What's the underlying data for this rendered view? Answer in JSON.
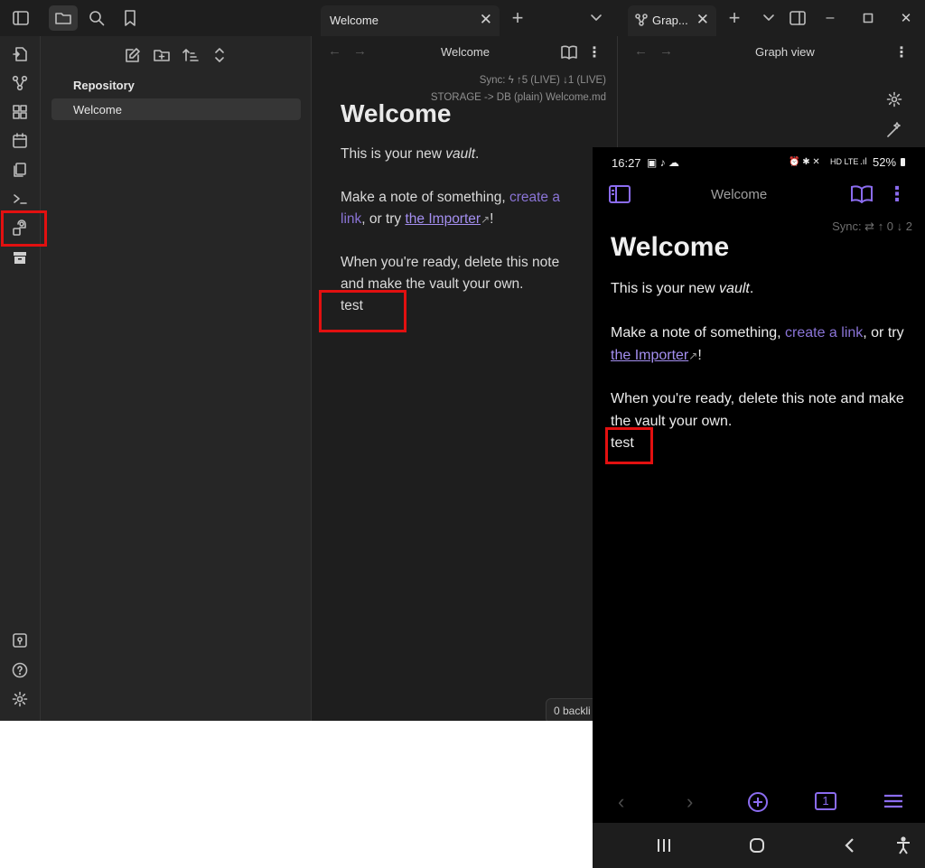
{
  "titlebar": {
    "tabs": [
      {
        "label": "Welcome"
      },
      {
        "label": "Grap..."
      }
    ],
    "new_tab": "+"
  },
  "sidebar": {
    "root_label": "Repository",
    "items": [
      {
        "label": "Welcome"
      }
    ]
  },
  "editor": {
    "header_title": "Welcome",
    "sync_status": "Sync: ϟ ↑5 (LIVE) ↓1 (LIVE)",
    "storage_status": "STORAGE -> DB (plain) Welcome.md",
    "heading": "Welcome",
    "line1_prefix": "This is your new ",
    "line1_em": "vault",
    "line1_suffix": ".",
    "line2_prefix": "Make a note of something, ",
    "line2_link1": "create a link",
    "line2_mid": ", or try ",
    "line2_link2": "the Importer",
    "line2_suffix": "!",
    "line3": "When you're ready, delete this note and make the vault your own.",
    "test_line": "test",
    "backlinks": "0 backli"
  },
  "graph": {
    "header_title": "Graph view"
  },
  "phone": {
    "time": "16:27",
    "battery": "52%",
    "network": "HD LTE",
    "header_title": "Welcome",
    "sync_status": "Sync: ⇄ ↑ 0 ↓ 2",
    "heading": "Welcome",
    "line1_prefix": "This is your new ",
    "line1_em": "vault",
    "line1_suffix": ".",
    "line2_prefix": "Make a note of something, ",
    "line2_link1": "create a link",
    "line2_mid": ", or try ",
    "line2_link2": "the Importer",
    "line2_suffix": "!",
    "line3": "When you're ready, delete this note and make the vault your own.",
    "test_line": "test",
    "tab_count": "1"
  },
  "colors": {
    "accent": "#8b6cf0",
    "highlight": "#e21010",
    "background": "#1e1e1e"
  }
}
